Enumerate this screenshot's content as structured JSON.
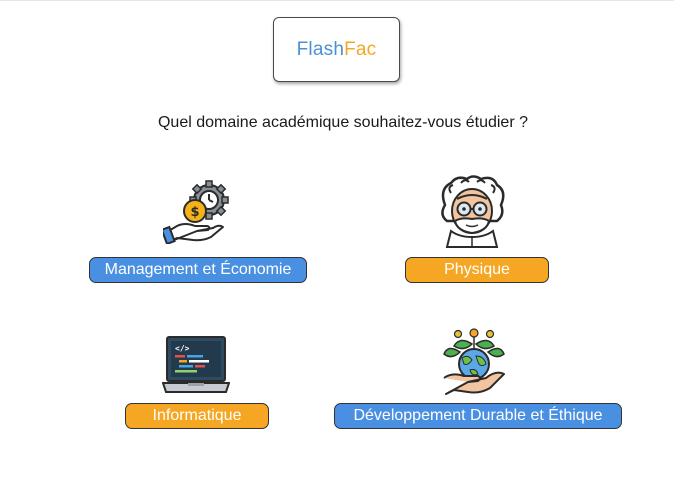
{
  "logo": {
    "part1": "Flash",
    "part2": "Fac"
  },
  "question": "Quel domaine académique souhaitez-vous étudier ?",
  "domains": [
    {
      "label": "Management et Économie",
      "icon": "money-gear-hand-icon",
      "color": "#4a90e2"
    },
    {
      "label": "Physique",
      "icon": "scientist-icon",
      "color": "#f5a623"
    },
    {
      "label": "Informatique",
      "icon": "laptop-code-icon",
      "color": "#f5a623"
    },
    {
      "label": "Développement Durable et Éthique",
      "icon": "earth-plant-hand-icon",
      "color": "#4a90e2"
    }
  ]
}
